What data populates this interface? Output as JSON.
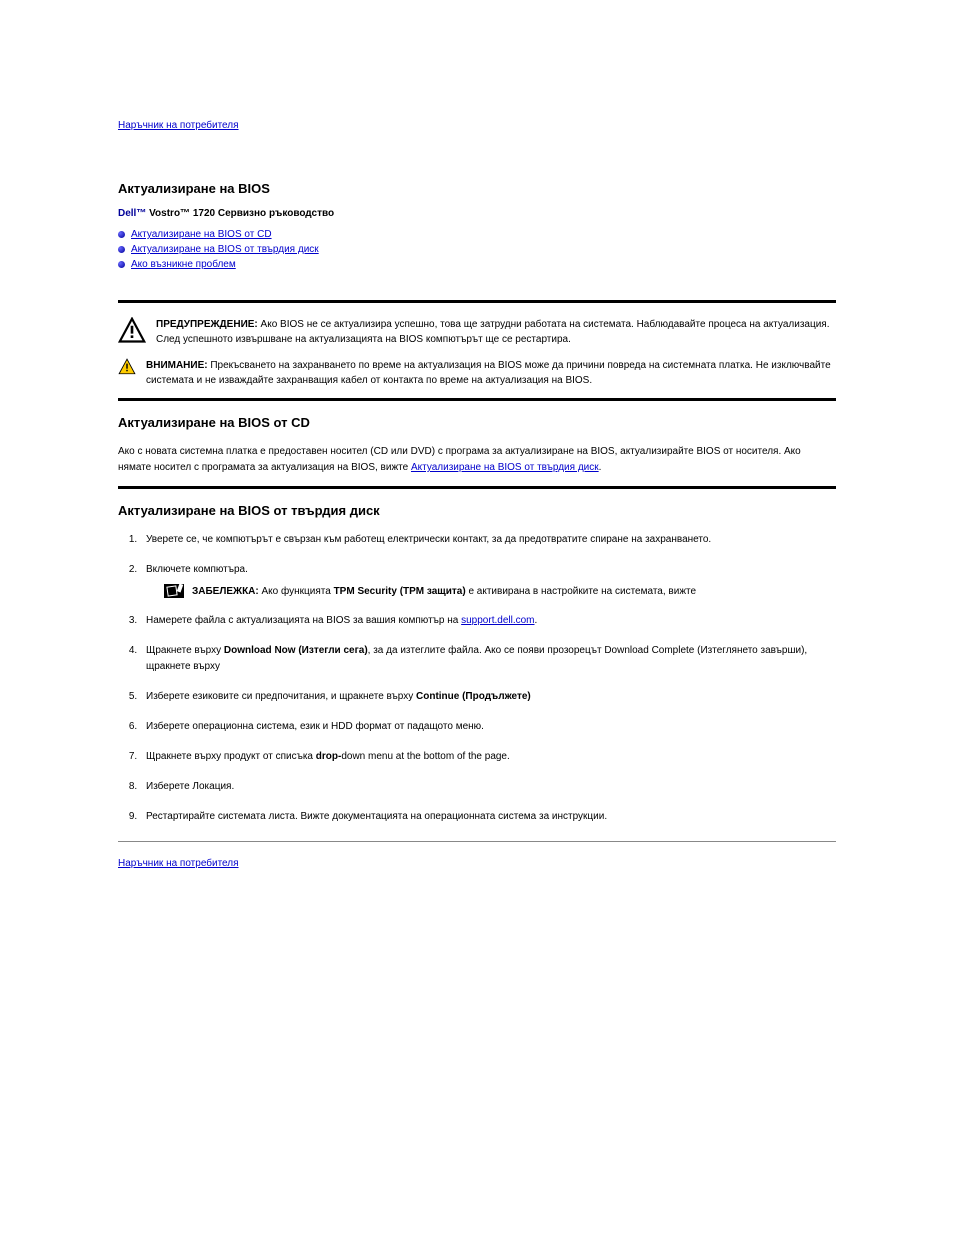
{
  "nav": {
    "back_top": "Наръчник на потребителя",
    "back_bottom": "Наръчник на потребителя"
  },
  "header": {
    "title": "Актуализиране на BIOS",
    "brand_prefix": "Dell™",
    "subtitle": "Vostro™ 1720 Сервизно ръководство"
  },
  "links": {
    "l1": "Актуализиране на BIOS от CD",
    "l2": "Актуализиране на BIOS от твърдия диск",
    "l3": "Ако възникне проблем",
    "support_link": "support.dell.com"
  },
  "callouts": {
    "warn1_lead": "ПРЕДУПРЕЖДЕНИЕ:",
    "warn1_text": " Ако BIOS не се актуализира успешно, това ще затрудни работата на системата. Наблюдавайте процеса на актуализация. След успешното извършване на актуализацията на BIOS компютърът ще се рестартира.",
    "caution_lead": "ВНИМАНИЕ:",
    "caution_text": " Прекъсването на захранването по време на актуализация на BIOS може да причини повреда на системната платка. Не изключвайте системата и не изваждайте захранващия кабел от контакта по време на актуализация на BIOS."
  },
  "sections": {
    "from_cd": {
      "heading": "Актуализиране на BIOS от CD",
      "intro_pre": "Ако с новата системна платка е предоставен носител (CD или DVD) с програма за актуализиране на BIOS, актуализирайте BIOS от носителя. Ако нямате носител с програмата за актуализация на BIOS, вижте ",
      "intro_link": "Актуализиране на BIOS от твърдия диск",
      "intro_post": "."
    },
    "from_hdd": {
      "heading": "Актуализиране на BIOS от твърдия диск",
      "step1": "Уверете се, че компютърът е свързан към работещ електрически контакт, за да предотвратите спиране на захранването.",
      "step2": "Включете компютъра.",
      "note_lead": "ЗАБЕЛЕЖКА:",
      "note_text1": " Ако функцията ",
      "note_bold": "TPM Security (TPM защита)",
      "note_text2": " е активирана в настройките на системата, вижте ",
      "step3_pre": "Намерете файла с актуализацията на BIOS за вашия компютър на ",
      "step3_post": ".",
      "step4_pre": "Щракнете върху ",
      "step4_bold": "Download Now (Изтегли сега)",
      "step4_post": ", за да изтеглите файла. Ако се появи прозорецът Download Complete (Изтеглянето завърши), щракнете върху ",
      "step5": "Изберете езиковите си предпочитания, и щракнете върху ",
      "step5_bold": "Continue (Продължете)",
      "step6": "Изберете операционна система, език и HDD формат от падащото меню.",
      "step7_pre": "Щракнете върху продукт от списъка ",
      "step7_bold": "drop-",
      "step7_post": "down menu at the bottom of the page.",
      "step8": "Изберете Локация.",
      "step9_pre": "Рестартирайте системата ",
      "step9_post": " листа. Вижте документацията на операционната система за инструкции."
    }
  }
}
